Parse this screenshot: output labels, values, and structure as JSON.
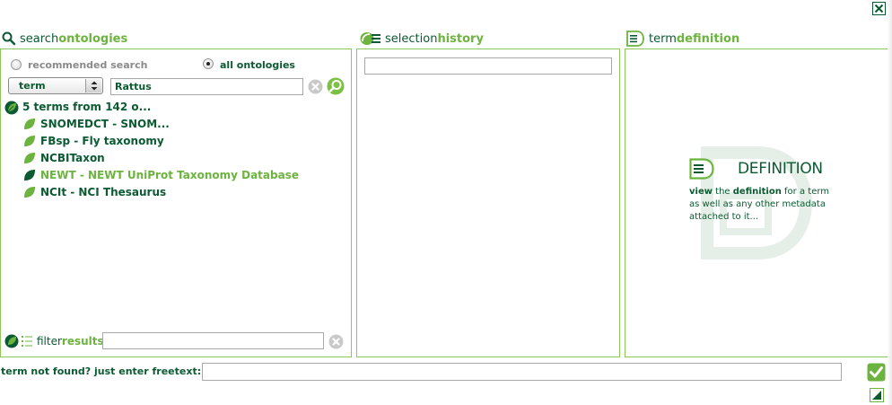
{
  "window": {
    "close_icon": "close-x-icon"
  },
  "search_panel": {
    "title_prefix": "search",
    "title_suffix": "ontologies",
    "radio_recommended_label": "recommended search",
    "radio_all_label": "all ontologies",
    "selected_radio": "all ontologies",
    "field_select_value": "term",
    "search_value": "Rattus",
    "results_summary": "5 terms from 142 o...",
    "results": [
      {
        "label": "SNOMEDCT - SNOM...",
        "highlighted": false
      },
      {
        "label": "FBsp - Fly taxonomy",
        "highlighted": false
      },
      {
        "label": "NCBITaxon",
        "highlighted": false
      },
      {
        "label": "NEWT - NEWT UniProt Taxonomy Database",
        "highlighted": true
      },
      {
        "label": "NCIt - NCI Thesaurus",
        "highlighted": false
      }
    ],
    "filter_prefix": "filter",
    "filter_suffix": "results",
    "filter_value": ""
  },
  "history_panel": {
    "title_prefix": "selection",
    "title_suffix": "history",
    "input_value": ""
  },
  "definition_panel": {
    "title_prefix": "term",
    "title_suffix": "definition",
    "placeholder_heading": "DEFINITION",
    "desc_1": "view",
    "desc_2": " the ",
    "desc_3": "definition",
    "desc_4": " for a term as well as any other metadata attached to it..."
  },
  "footer": {
    "freetext_label": "term not found? just enter freetext:",
    "freetext_value": ""
  },
  "colors": {
    "accent_green": "#6db33f",
    "dark_green": "#0b5a32",
    "border_green": "#8fc65a"
  }
}
